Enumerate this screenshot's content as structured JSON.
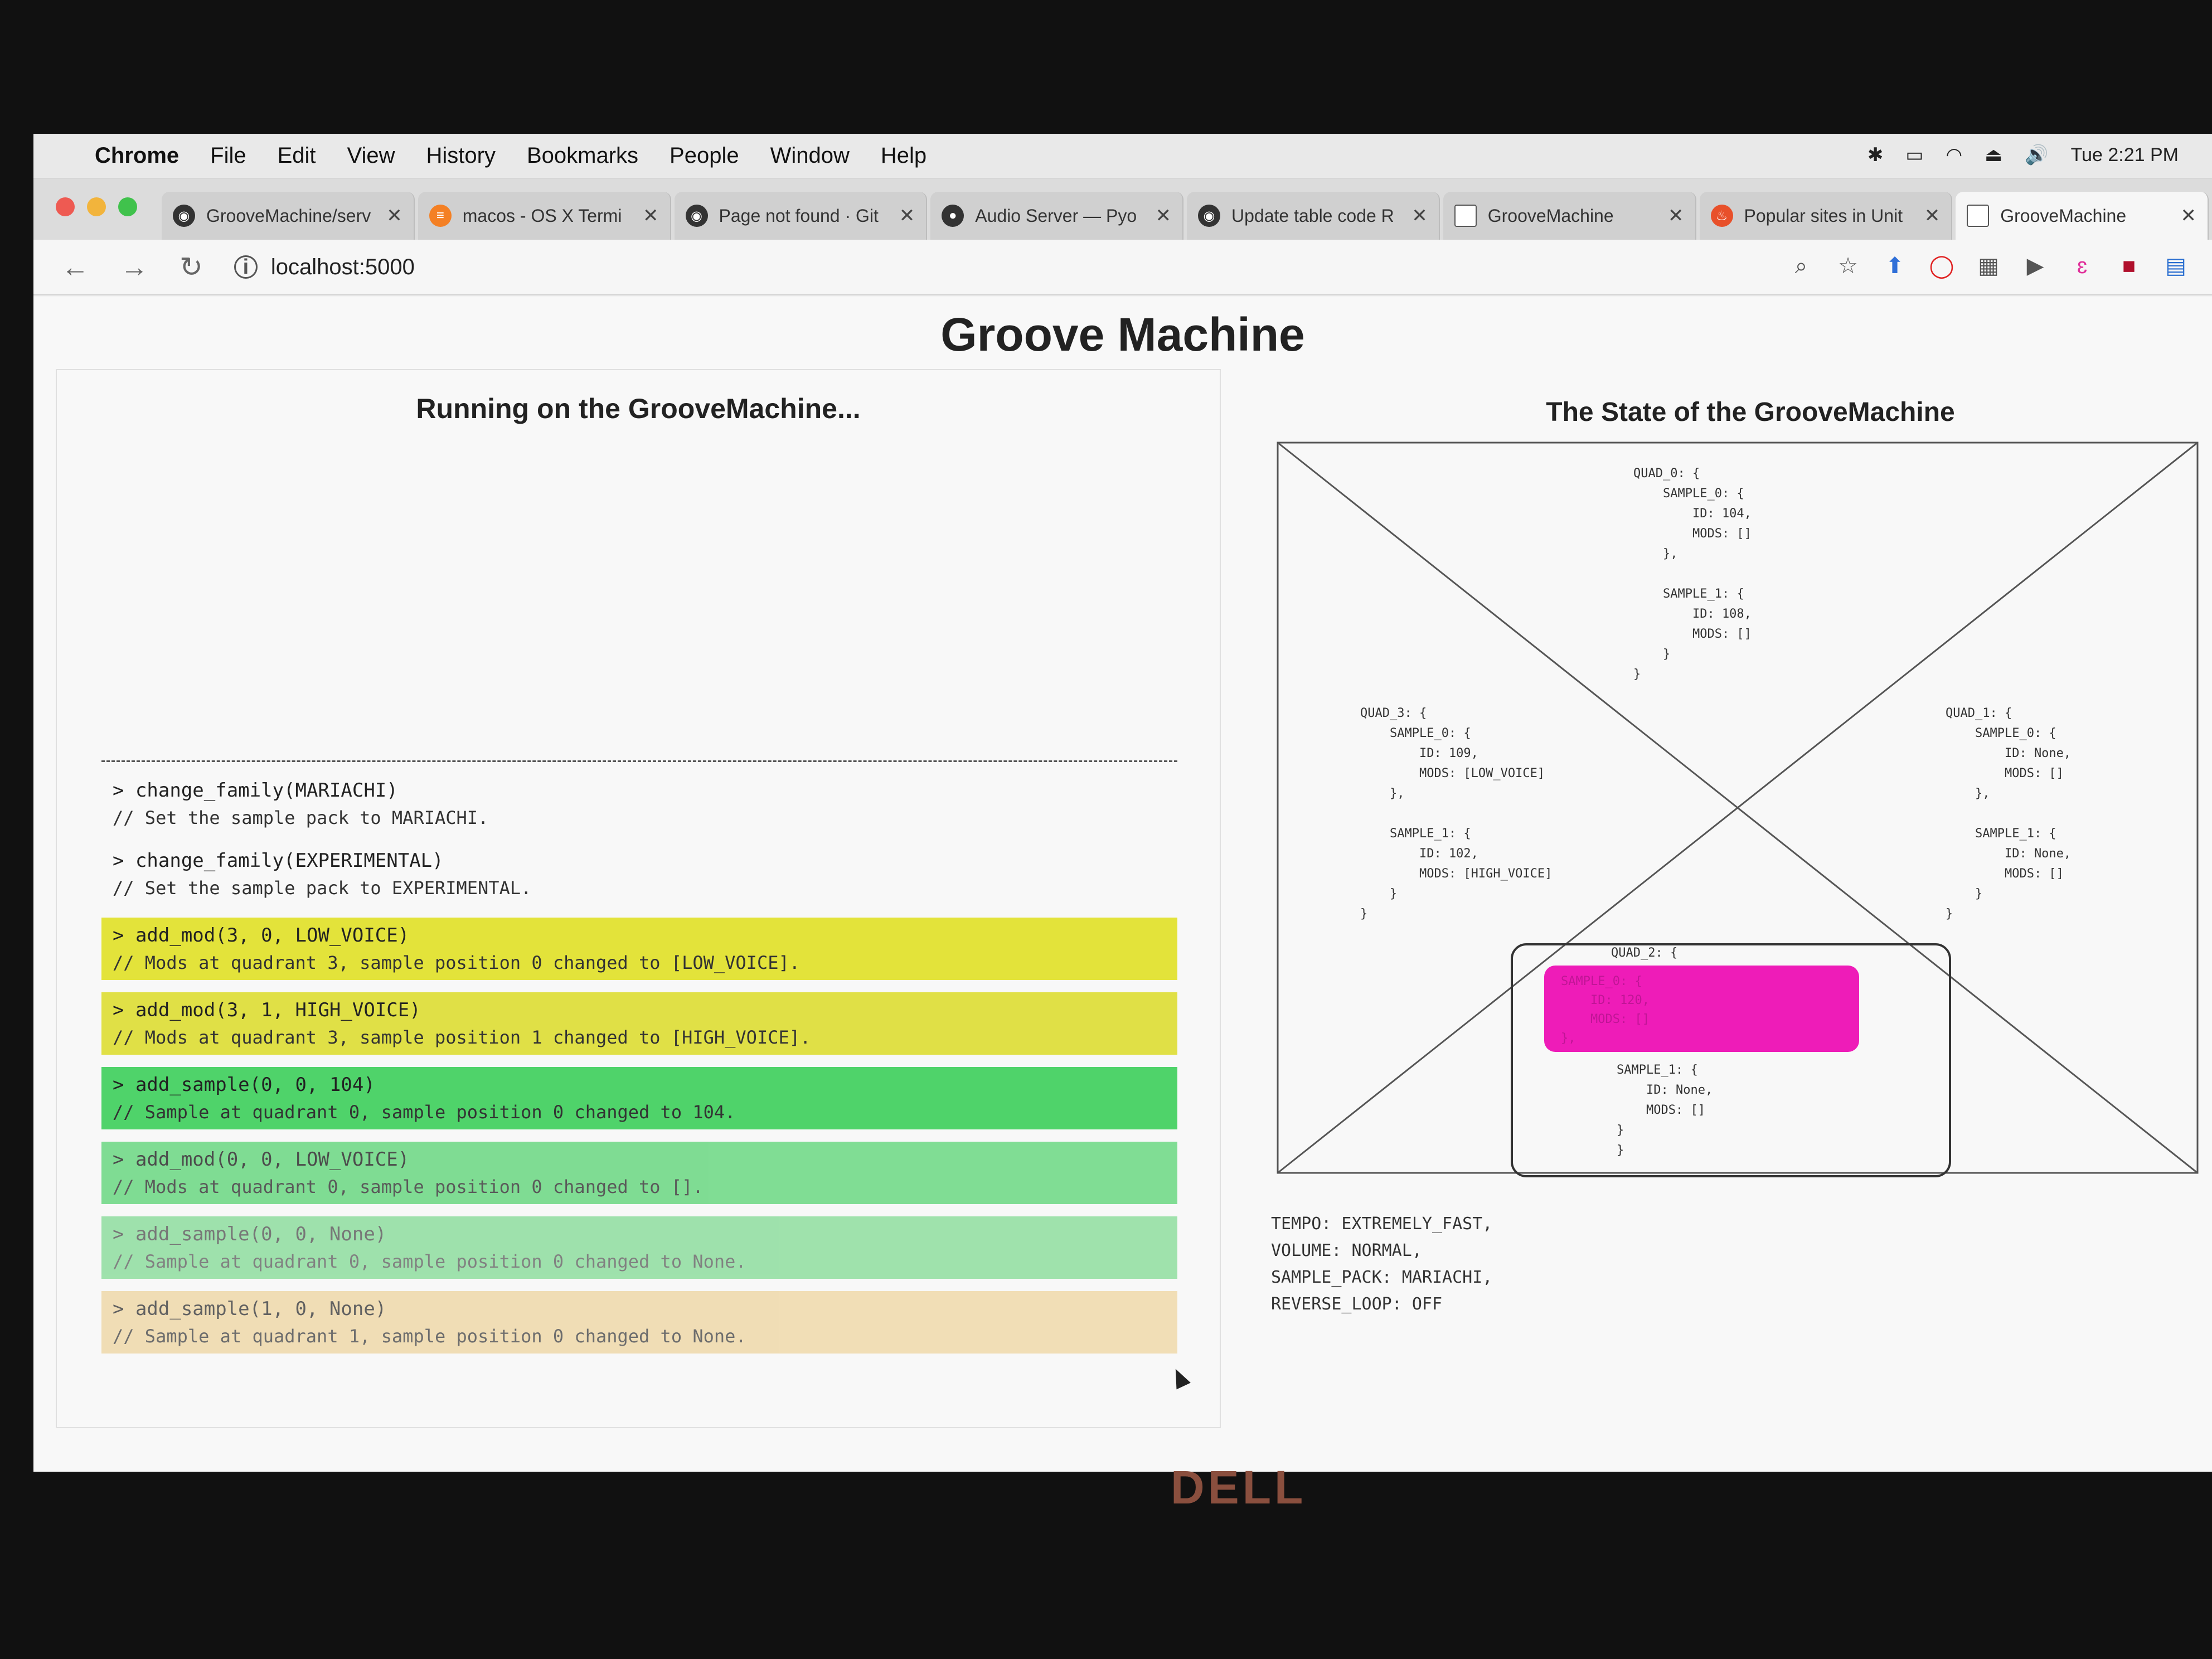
{
  "menubar": {
    "items": [
      "Chrome",
      "File",
      "Edit",
      "View",
      "History",
      "Bookmarks",
      "People",
      "Window",
      "Help"
    ],
    "clock": "Tue 2:21 PM"
  },
  "tabs": [
    {
      "title": "GrooveMachine/serv",
      "icon": "github-icon"
    },
    {
      "title": "macos - OS X Termi",
      "icon": "stackoverflow-icon"
    },
    {
      "title": "Page not found · Git",
      "icon": "github-icon"
    },
    {
      "title": "Audio Server — Pyo",
      "icon": "pyo-icon"
    },
    {
      "title": "Update table code R",
      "icon": "github-icon"
    },
    {
      "title": "GrooveMachine",
      "icon": "page-icon"
    },
    {
      "title": "Popular sites in Unit",
      "icon": "fire-icon"
    },
    {
      "title": "GrooveMachine",
      "icon": "page-icon"
    }
  ],
  "toolbar": {
    "url": "localhost:5000"
  },
  "page": {
    "title": "Groove Machine",
    "left_title": "Running on the GrooveMachine...",
    "right_title": "The State of the GrooveMachine"
  },
  "log": [
    {
      "cmd": "> change_family(MARIACHI)",
      "out": "// Set the sample pack to MARIACHI.",
      "style": "plain"
    },
    {
      "cmd": "> change_family(EXPERIMENTAL)",
      "out": "// Set the sample pack to EXPERIMENTAL.",
      "style": "plain"
    },
    {
      "cmd": "> add_mod(3, 0, LOW_VOICE)",
      "out": "// Mods at quadrant 3, sample position 0 changed to [LOW_VOICE].",
      "style": "yellow"
    },
    {
      "cmd": "> add_mod(3, 1, HIGH_VOICE)",
      "out": "// Mods at quadrant 3, sample position 1 changed to [HIGH_VOICE].",
      "style": "yellow2"
    },
    {
      "cmd": "> add_sample(0, 0, 104)",
      "out": "// Sample at quadrant 0, sample position 0 changed to 104.",
      "style": "green"
    },
    {
      "cmd": "> add_mod(0, 0, LOW_VOICE)",
      "out": "// Mods at quadrant 0, sample position 0 changed to [].",
      "style": "green2"
    },
    {
      "cmd": "> add_sample(0, 0, None)",
      "out": "// Sample at quadrant 0, sample position 0 changed to None.",
      "style": "green3"
    },
    {
      "cmd": "> add_sample(1, 0, None)",
      "out": "// Sample at quadrant 1, sample position 0 changed to None.",
      "style": "orange"
    }
  ],
  "state": {
    "quad0": "QUAD_0: {\n    SAMPLE_0: {\n        ID: 104,\n        MODS: []\n    },\n\n    SAMPLE_1: {\n        ID: 108,\n        MODS: []\n    }\n}",
    "quad1": "QUAD_1: {\n    SAMPLE_0: {\n        ID: None,\n        MODS: []\n    },\n\n    SAMPLE_1: {\n        ID: None,\n        MODS: []\n    }\n}",
    "quad3": "QUAD_3: {\n    SAMPLE_0: {\n        ID: 109,\n        MODS: [LOW_VOICE]\n    },\n\n    SAMPLE_1: {\n        ID: 102,\n        MODS: [HIGH_VOICE]\n    }\n}",
    "quad2_head": "QUAD_2: {",
    "quad2_highlight": "SAMPLE_0: {\n    ID: 120,\n    MODS: []\n},",
    "quad2_tail": "SAMPLE_1: {\n    ID: None,\n    MODS: []\n}\n}",
    "highlight_color": "#ee1cb8"
  },
  "settings": [
    "TEMPO: EXTREMELY_FAST,",
    "VOLUME: NORMAL,",
    "SAMPLE_PACK: MARIACHI,",
    "REVERSE_LOOP: OFF"
  ],
  "brand": "DELL"
}
